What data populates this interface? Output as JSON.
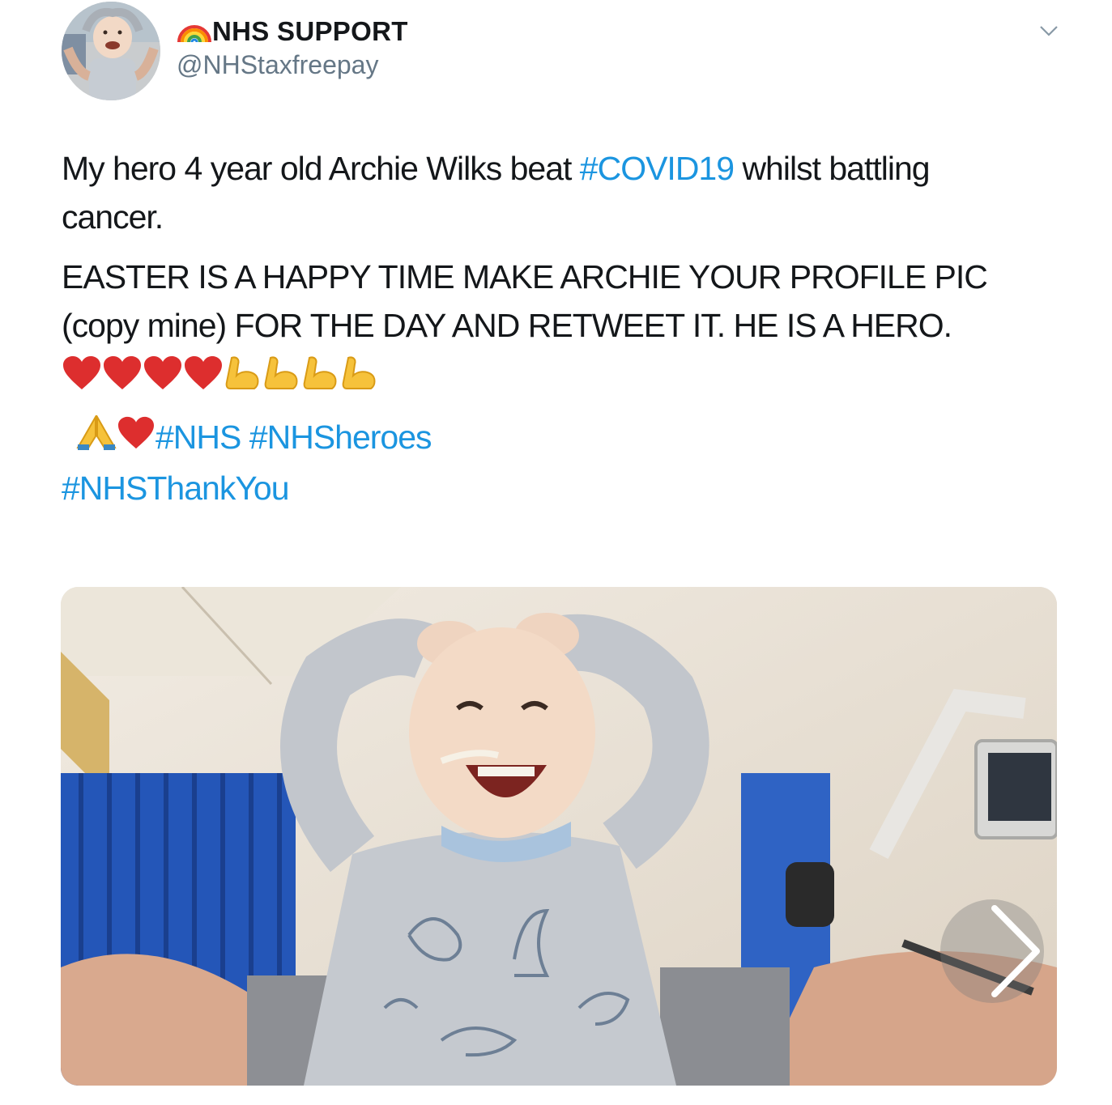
{
  "user": {
    "display_name": "NHS SUPPORT",
    "name_emoji": "rainbow-emoji",
    "handle": "@NHStaxfreepay",
    "avatar": "avatar-photo"
  },
  "tweet": {
    "para1_before": "My hero 4 year old Archie Wilks beat ",
    "hashtag_covid": "#COVID19",
    "para1_after": " whilst battling",
    "para1_line2": "cancer.",
    "para2_line1": "EASTER IS A HAPPY TIME MAKE ARCHIE YOUR PROFILE PIC",
    "para2_line2": "(copy mine) FOR THE DAY AND RETWEET IT. HE IS A HERO.",
    "emoji_line": [
      "heart-emoji",
      "heart-emoji",
      "heart-emoji",
      "heart-emoji",
      "flexed-biceps-emoji",
      "flexed-biceps-emoji",
      "flexed-biceps-emoji",
      "flexed-biceps-emoji"
    ],
    "hashtag_line_emoji": [
      "folded-hands-emoji",
      "heart-emoji"
    ],
    "hashtag_nhs": "#NHS",
    "hashtag_nhsheroes": "#NHSheroes",
    "hashtag_thankyou": "#NHSThankYou"
  },
  "media": {
    "image": "photo-child-hospital",
    "next_icon": "chevron-right-icon"
  },
  "menu_icon": "chevron-down-icon",
  "colors": {
    "link": "#1b95e0",
    "text": "#14171a",
    "secondary": "#657786"
  }
}
